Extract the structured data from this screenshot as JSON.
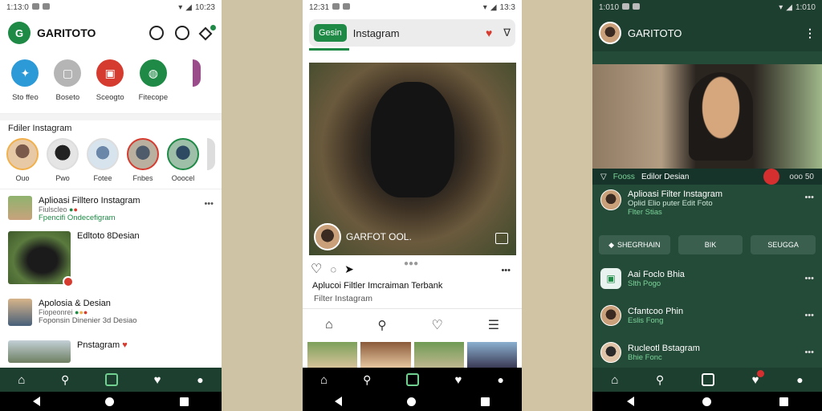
{
  "colors": {
    "green": "#1e8a46",
    "dark_green": "#244a38",
    "nav_green": "#1d3f30",
    "red": "#d63b2f",
    "blue": "#2d9ad8",
    "grey": "#b5b5b5"
  },
  "phone1": {
    "status": {
      "time": "1:13:0",
      "battery": "10:23"
    },
    "header": {
      "logo": "G",
      "title": "GARITOTO"
    },
    "actions": [
      {
        "label": "Sto ffeo",
        "icon": "share-icon",
        "color": "#2d9ad8"
      },
      {
        "label": "Boseto",
        "icon": "square-icon",
        "color": "#b5b5b5"
      },
      {
        "label": "Sceogto",
        "icon": "app-icon",
        "color": "#d63b2f"
      },
      {
        "label": "Fitecope",
        "icon": "chat-icon",
        "color": "#1e8a46"
      }
    ],
    "stories_title": "Fdiler Instagram",
    "stories": [
      {
        "label": "Ouo"
      },
      {
        "label": "Pwo"
      },
      {
        "label": "Fotee"
      },
      {
        "label": "Fnbes"
      },
      {
        "label": "Ooocel"
      }
    ],
    "feed": [
      {
        "title": "Aplioasi Filltero Instagram",
        "line2": "Fiulscleo",
        "line3": "Fpencifi Ondecefigram",
        "more": "•••"
      },
      {
        "title": "Edltoto 8Desian"
      },
      {
        "title": "Apolosia & Desian",
        "line2": "Fiopeonrei",
        "line3": "Foponsin Dinenier 3d Desiao"
      },
      {
        "title": "Pnstagram"
      }
    ]
  },
  "phone2": {
    "status": {
      "time": "12:31",
      "battery": "13:3"
    },
    "header": {
      "logo": "Gesin",
      "title": "Instagram"
    },
    "post": {
      "username": "GARFOT OOL.",
      "caption": "Aplucoi Filtler Imcraiman Terbank",
      "subcaption": "Filter Instagram",
      "more": "•••"
    }
  },
  "phone3": {
    "status": {
      "time": "1:010",
      "battery": "1:010"
    },
    "header": {
      "title": "GARITOTO"
    },
    "banner": {
      "left": "Fooss",
      "title": "Edilor Desian",
      "right": "ooo 50"
    },
    "post": {
      "title": "Aplioasi Filter Instagram",
      "line2": "Oplid Elio puter Edit Foto",
      "line3": "Flter Stias",
      "more": "•••"
    },
    "buttons": [
      "SHEGRHAIN",
      "BIK",
      "SEUGGA"
    ],
    "list": [
      {
        "title": "Aai Foclo Bhia",
        "sub": "Slth Pogo",
        "more": "•••"
      },
      {
        "title": "Cfantcoo Phin",
        "sub": "Eslis Fong",
        "more": "•••"
      },
      {
        "title": "Rucleotl Bstagram",
        "sub": "Bhie Fonc",
        "more": "•••"
      }
    ]
  }
}
